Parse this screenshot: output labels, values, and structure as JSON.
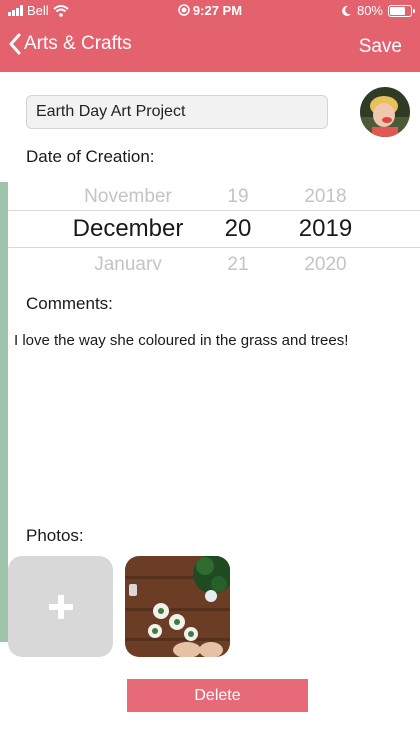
{
  "status_bar": {
    "carrier": "Bell",
    "time": "9:27 PM",
    "battery_percent": "80%",
    "battery_level": 0.8
  },
  "nav": {
    "back_label": "Arts & Crafts",
    "save_label": "Save"
  },
  "form": {
    "title_value": "Earth Day Art Project",
    "date_label": "Date of Creation:",
    "comments_label": "Comments:",
    "comments_text": "I love the way she coloured in the grass and trees!",
    "photos_label": "Photos:",
    "delete_label": "Delete"
  },
  "date_picker": {
    "above": {
      "month": "November",
      "day": "19",
      "year": "2018"
    },
    "selected": {
      "month": "December",
      "day": "20",
      "year": "2019"
    },
    "below": {
      "month": "January",
      "day": "21",
      "year": "2020"
    }
  },
  "colors": {
    "accent": "#e4616e",
    "delete_button": "#e66a78"
  },
  "icons": {
    "back": "chevron-left-icon",
    "add_photo": "plus-icon"
  }
}
